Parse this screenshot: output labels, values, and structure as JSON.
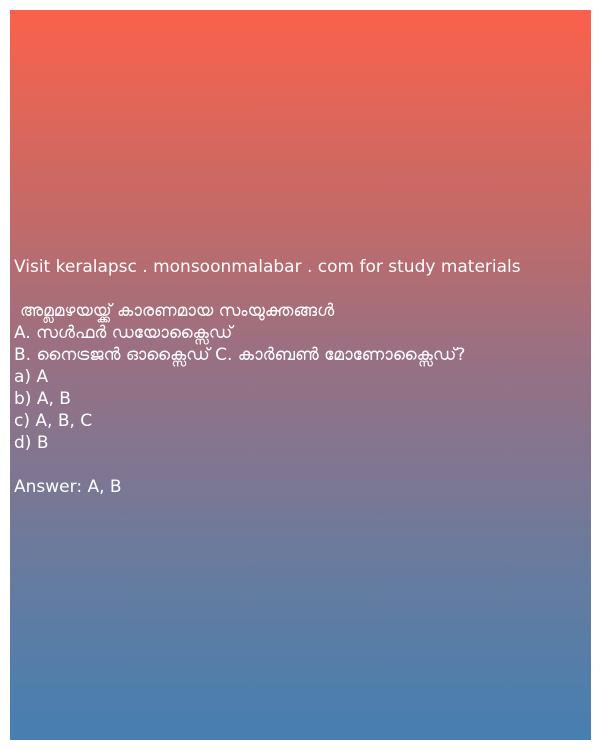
{
  "card": {
    "promo_text": "Visit keralapsc . monsoonmalabar . com for study materials",
    "question": "അമ്ലമഴയയ്ക്ക് കാരണമായ സംയുക്തങ്ങൾ",
    "statement_a": "A. സൾഫർ ഡയോക്സൈഡ്",
    "statement_b_c": "B. നൈട്രജൻ ഓക്സൈഡ്  C. കാർബൺ മോണോക്സൈഡ്?",
    "options": {
      "a": "a) A",
      "b": "b) A, B",
      "c": "c) A, B, C",
      "d": "d) B"
    },
    "answer": "Answer: A, B"
  },
  "colors": {
    "gradient_top": "#fb614b",
    "gradient_bottom": "#467fb1",
    "text": "#ffffff",
    "page_background": "#ffffff"
  }
}
